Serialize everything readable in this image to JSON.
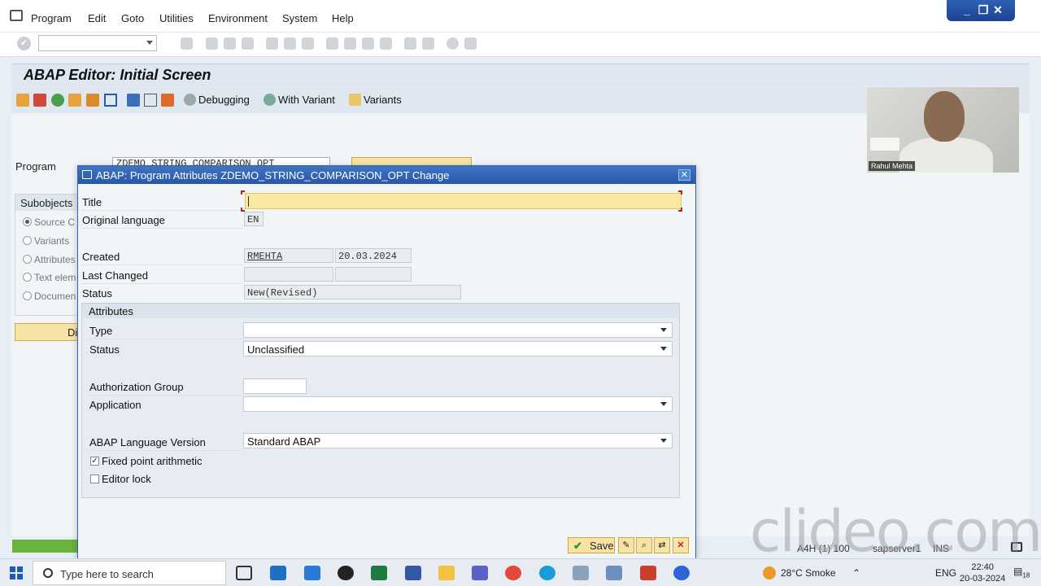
{
  "menu": {
    "items": [
      "Program",
      "Edit",
      "Goto",
      "Utilities",
      "Environment",
      "System",
      "Help"
    ],
    "window_controls": [
      "_",
      "❐",
      "✕"
    ]
  },
  "screen": {
    "title": "ABAP Editor: Initial Screen",
    "app_toolbar": {
      "debugging": "Debugging",
      "with_variant": "With Variant",
      "variants": "Variants"
    },
    "program_label": "Program",
    "program_value": "ZDEMO_STRING_COMPARISON_OPT",
    "subobjects_header": "Subobjects",
    "subobjects": [
      "Source C",
      "Variants",
      "Attributes",
      "Text elem",
      "Documen"
    ],
    "display_label": "Di"
  },
  "webcam": {
    "name": "Rahul Mehta"
  },
  "dialog": {
    "title": "ABAP: Program Attributes ZDEMO_STRING_COMPARISON_OPT Change",
    "close": "✕",
    "title_label": "Title",
    "title_value": "",
    "orig_lang_label": "Original language",
    "orig_lang_value": "EN",
    "created_label": "Created",
    "created_by": "RMEHTA",
    "created_on": "20.03.2024",
    "last_changed_label": "Last Changed",
    "last_changed_by": "",
    "last_changed_on": "",
    "status_label": "Status",
    "status_value": "New(Revised)",
    "attributes": {
      "header": "Attributes",
      "type_label": "Type",
      "type_value": "",
      "status_label": "Status",
      "status_value": "Unclassified",
      "auth_group_label": "Authorization Group",
      "auth_group_value": "",
      "application_label": "Application",
      "application_value": "",
      "abap_lang_label": "ABAP Language Version",
      "abap_lang_value": "Standard ABAP",
      "fixed_point_label": "Fixed point arithmetic",
      "fixed_point_checked": true,
      "editor_lock_label": "Editor lock",
      "editor_lock_checked": false
    },
    "save_label": "Save"
  },
  "statusbar": {
    "system": "A4H (1) 100",
    "server": "sapserver1",
    "mode": "INS"
  },
  "watermark": "clideo.com",
  "taskbar": {
    "search_placeholder": "Type here to search",
    "weather": "28°C  Smoke",
    "lang": "ENG",
    "time": "22:40",
    "date": "20-03-2024",
    "notif_count": "18"
  },
  "colors": {
    "accent": "#2756a6",
    "highlight": "#f9e8a0",
    "button": "#f7e3a6",
    "save_check": "#2b9a2b"
  }
}
